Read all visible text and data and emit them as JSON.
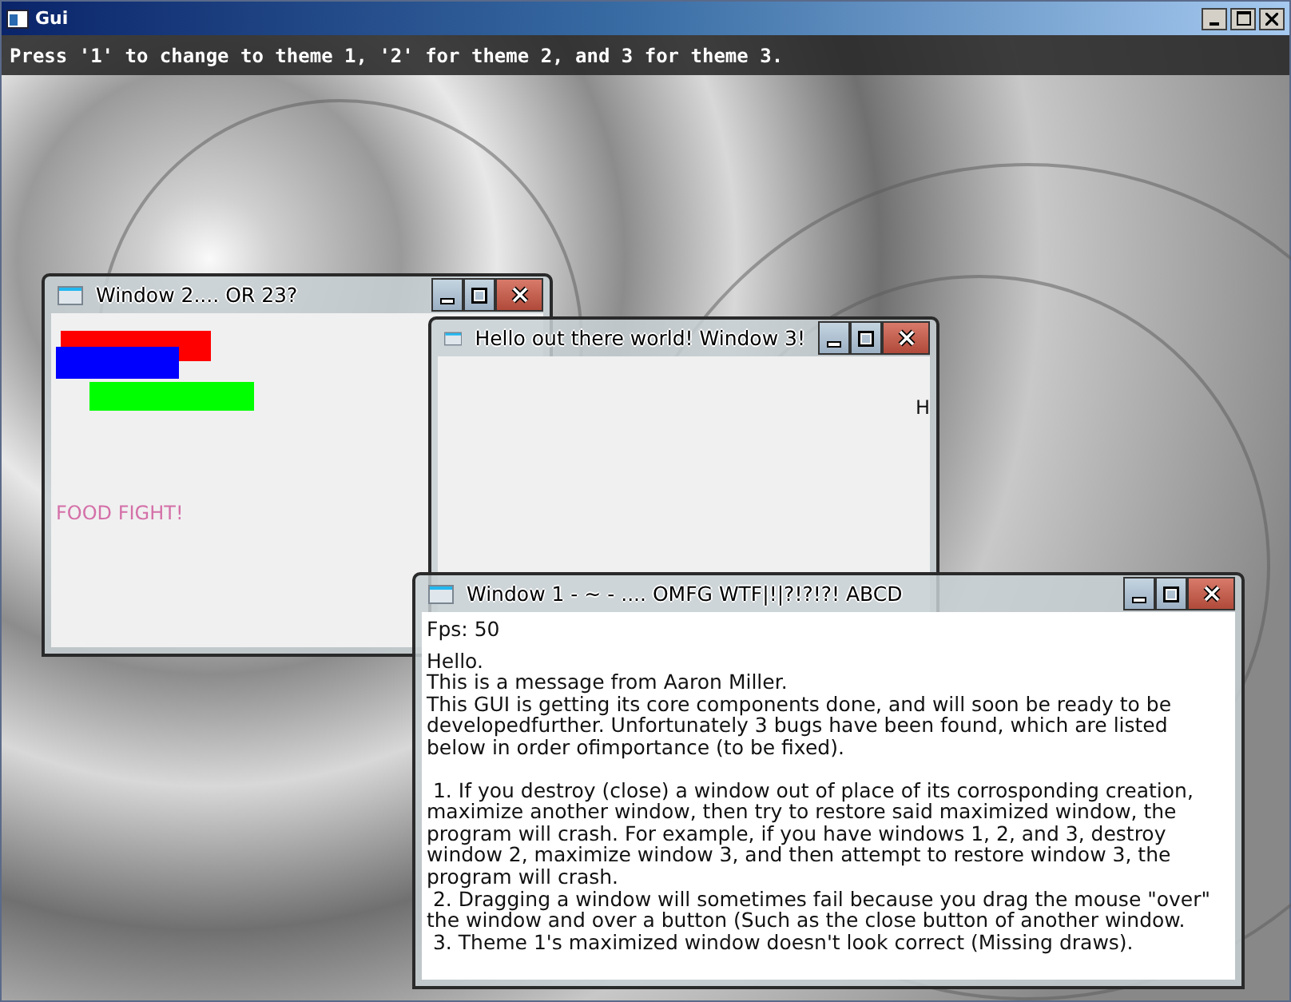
{
  "window": {
    "title": "Gui"
  },
  "banner": {
    "text": "Press '1' to change to theme 1, '2' for theme 2, and 3 for theme 3."
  },
  "windows": [
    {
      "kind": "shapes",
      "title": "Window 2.... OR 23?",
      "shapes": [
        {
          "color": "#ff0000"
        },
        {
          "color": "#0000ff"
        },
        {
          "color": "#00ff00"
        }
      ],
      "text": "FOOD FIGHT!"
    },
    {
      "kind": "blank",
      "title": "Hello out there world! Window 3!",
      "edge_text": "H"
    },
    {
      "kind": "text",
      "title": "Window 1 - ~ - .... OMFG WTF|!|?!?!?! ABCD",
      "fps": "Fps: 50",
      "paragraphs": [
        "Hello.",
        "This is a message from Aaron Miller.",
        "This GUI is getting its core components done, and will soon be ready to be developedfurther. Unfortunately 3 bugs have been found, which are listed below in order ofimportance (to be fixed).",
        " 1. If you destroy (close) a window out of place of its corrosponding creation, maximize another window, then try to restore said maximized window, the program will crash. For example, if you have windows 1, 2, and 3, destroy window 2, maximize window 3, and then attempt to restore window 3, the program will crash.",
        " 2. Dragging a window will sometimes fail because you drag the mouse \"over\" the window and over a button (Such as the close button of another window.",
        " 3. Theme 1's maximized window doesn't look correct (Missing draws)."
      ]
    }
  ]
}
